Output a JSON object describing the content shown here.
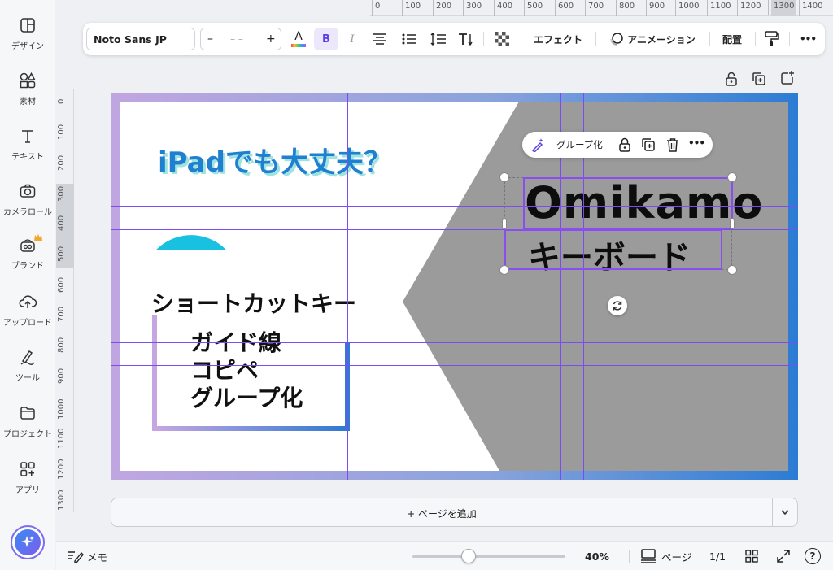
{
  "sidebar": {
    "items": [
      {
        "label": "デザイン",
        "icon": "design-icon"
      },
      {
        "label": "素材",
        "icon": "elements-icon"
      },
      {
        "label": "テキスト",
        "icon": "text-icon"
      },
      {
        "label": "カメラロール",
        "icon": "camera-icon"
      },
      {
        "label": "ブランド",
        "icon": "brand-icon"
      },
      {
        "label": "アップロード",
        "icon": "upload-icon"
      },
      {
        "label": "ツール",
        "icon": "draw-icon"
      },
      {
        "label": "プロジェクト",
        "icon": "folder-icon"
      },
      {
        "label": "アプリ",
        "icon": "apps-icon"
      }
    ],
    "magic_icon": "sparkle-icon"
  },
  "ruler": {
    "top_ticks": [
      "0",
      "100",
      "200",
      "300",
      "400",
      "500",
      "600",
      "700",
      "800",
      "900",
      "1000",
      "1100",
      "1200",
      "1300",
      "1400"
    ],
    "left_ticks": [
      "0",
      "100",
      "200",
      "300",
      "400",
      "500",
      "600",
      "700",
      "800",
      "900",
      "1000",
      "1100",
      "1200",
      "1300"
    ]
  },
  "toolbar": {
    "font": "Noto Sans JP",
    "size_minus": "–",
    "size_value": "– –",
    "size_plus": "+",
    "color_letter": "A",
    "bold": "B",
    "italic": "I",
    "effects": "エフェクト",
    "animation": "アニメーション",
    "position": "配置",
    "more": "•••"
  },
  "canvas": {
    "title": "iPadでも大丈夫？",
    "subtitle": "ショートカットキー",
    "list": [
      "ガイド線",
      "コピペ",
      "グループ化"
    ],
    "brand": "Omikamo",
    "brand_sub": "キーボード",
    "colors": {
      "frame_start": "#c1a6e0",
      "frame_end": "#2c7cd4",
      "title": "#1f7fd1",
      "title_shadow": "#9fe3df",
      "guide": "#7a4df0",
      "gray": "#9b9b9b"
    }
  },
  "context_menu": {
    "group_label": "グループ化",
    "more": "•••"
  },
  "add_page": {
    "label": "+ ページを追加"
  },
  "bottombar": {
    "notes": "メモ",
    "zoom": "40%",
    "zoom_level": 0.4,
    "pages_label": "ページ",
    "page_count": "1/1",
    "help": "?"
  }
}
